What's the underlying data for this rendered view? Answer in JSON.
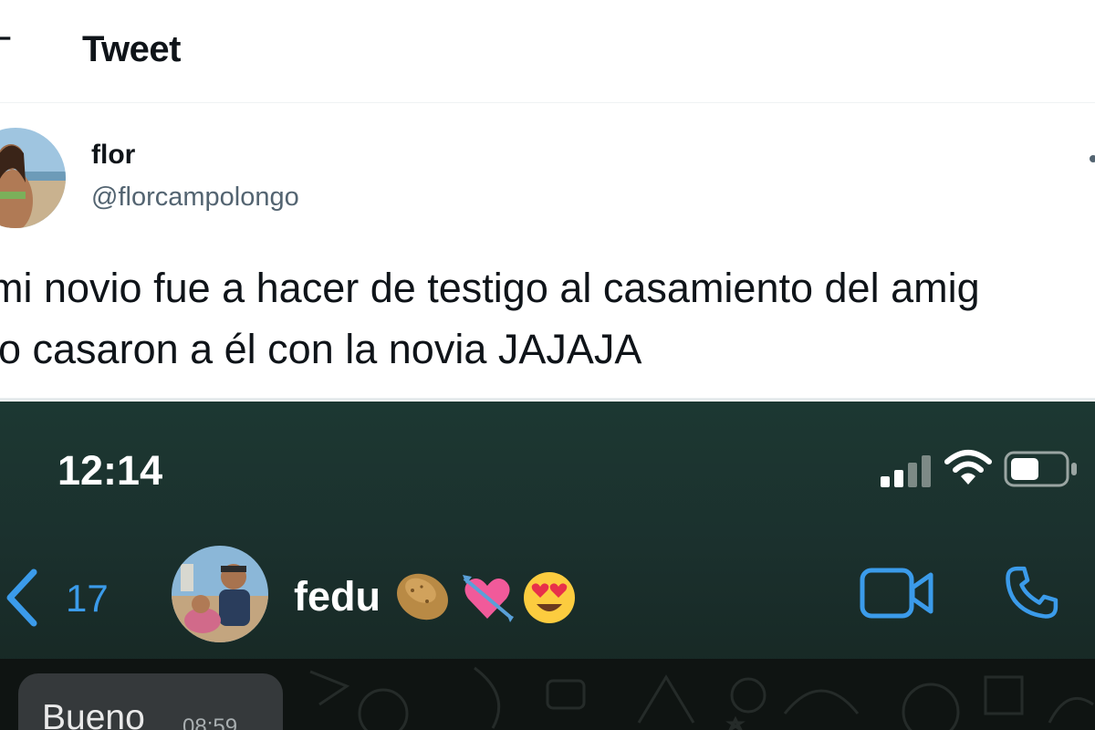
{
  "header": {
    "title": "Tweet"
  },
  "tweet": {
    "display_name": "flor",
    "handle": "@florcampolongo",
    "text_line1": "mi novio fue a hacer de testigo al casamiento del amig",
    "text_line2": "lo casaron a él con la novia JAJAJA"
  },
  "phone": {
    "time": "12:14",
    "back_count": "17",
    "contact_name": "fedu",
    "contact_emojis": [
      "🥔",
      "💘",
      "😍"
    ],
    "message_text": "Bueno",
    "message_time": "08:59"
  },
  "colors": {
    "accent_blue": "#3b9bea",
    "text_primary": "#0f1419",
    "text_secondary": "#536471",
    "chat_header_bg": "#1c3832",
    "chat_bg": "#0f1412",
    "bubble_bg": "#35393b"
  },
  "icons": [
    "back-arrow-icon",
    "more-icon",
    "signal-icon",
    "wifi-icon",
    "battery-icon",
    "chevron-left-icon",
    "video-call-icon",
    "phone-call-icon"
  ]
}
